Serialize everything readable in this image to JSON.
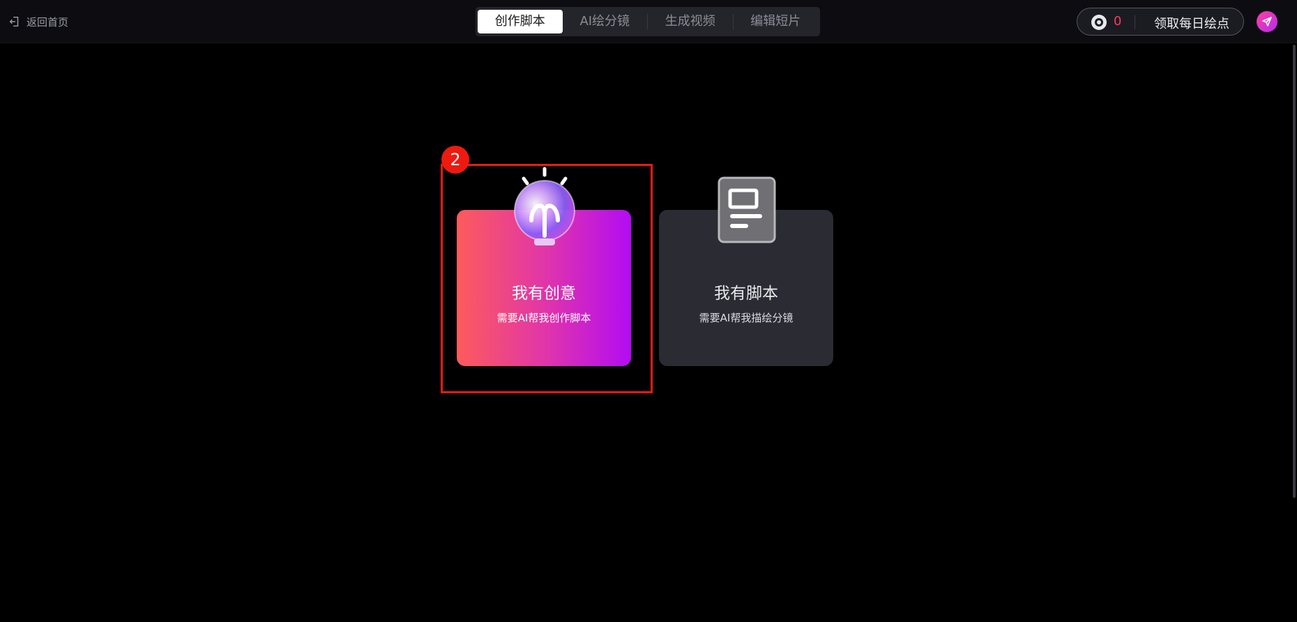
{
  "header": {
    "back_label": "返回首页",
    "tabs": [
      {
        "label": "创作脚本",
        "active": true
      },
      {
        "label": "AI绘分镜",
        "active": false
      },
      {
        "label": "生成视频",
        "active": false
      },
      {
        "label": "编辑短片",
        "active": false
      }
    ],
    "points_count": "0",
    "daily_points_label": "领取每日绘点"
  },
  "annotation": {
    "step_number": "2"
  },
  "cards": [
    {
      "title": "我有创意",
      "subtitle": "需要AI帮我创作脚本",
      "icon": "lightbulb-icon"
    },
    {
      "title": "我有脚本",
      "subtitle": "需要AI帮我描绘分镜",
      "icon": "document-icon"
    }
  ],
  "colors": {
    "accent_gradient": [
      "#fd5b5b",
      "#e136a8",
      "#b30cf2"
    ],
    "highlight_red": "#ee1a10",
    "count_color": "#ff3b5c"
  }
}
